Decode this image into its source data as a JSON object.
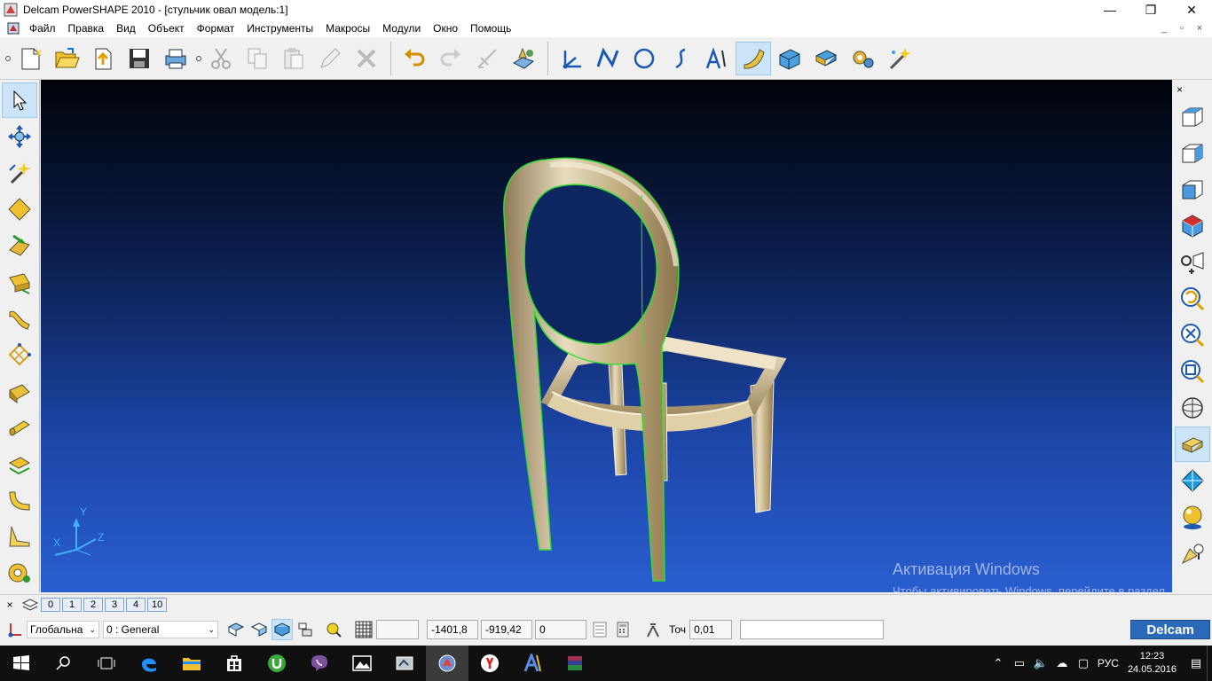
{
  "window": {
    "title": "Delcam PowerSHAPE 2010 - [стульчик овал модель:1]",
    "minimize": "—",
    "maximize": "❐",
    "close": "✕"
  },
  "menu": {
    "items": [
      "Файл",
      "Правка",
      "Вид",
      "Объект",
      "Формат",
      "Инструменты",
      "Макросы",
      "Модули",
      "Окно",
      "Помощь"
    ],
    "mdi": [
      "_",
      "▫",
      "×"
    ]
  },
  "toolbar": {
    "icons": [
      "new-icon",
      "open-icon",
      "import-icon",
      "save-icon",
      "print-icon",
      "cut-icon",
      "copy-icon",
      "paste-icon",
      "edit-icon",
      "delete-icon",
      "undo-icon",
      "redo-icon",
      "draw-icon",
      "render-icon",
      "workplane-icon",
      "line-icon",
      "circle-icon",
      "curve-icon",
      "text-icon",
      "surface-icon",
      "solid-icon",
      "assembly-icon",
      "tools-icon",
      "wizard-icon"
    ]
  },
  "viewport": {
    "axes": {
      "y": "Y",
      "x": "X",
      "z": "Z"
    },
    "watermark_title": "Активация Windows",
    "watermark_text": "Чтобы активировать Windows, перейдите в раздел \"Параметры\"."
  },
  "levels": {
    "close": "×",
    "items": [
      "0",
      "1",
      "2",
      "3",
      "4",
      "10"
    ]
  },
  "status": {
    "workplane": "Глобальна",
    "level": "0 : General",
    "coord_x": "-1401,8",
    "coord_y": "-919,42",
    "coord_z": "0",
    "tolerance_label": "Точ",
    "tolerance_value": "0,01",
    "brand": "Delcam"
  },
  "taskbar": {
    "lang": "РУС",
    "time": "12:23",
    "date": "24.05.2016"
  },
  "colors": {
    "viewport_top": "#000308",
    "viewport_bottom": "#2a5ed0",
    "model": "#c9b68e",
    "outline": "#33dd33",
    "brand": "#2a6ab8"
  }
}
